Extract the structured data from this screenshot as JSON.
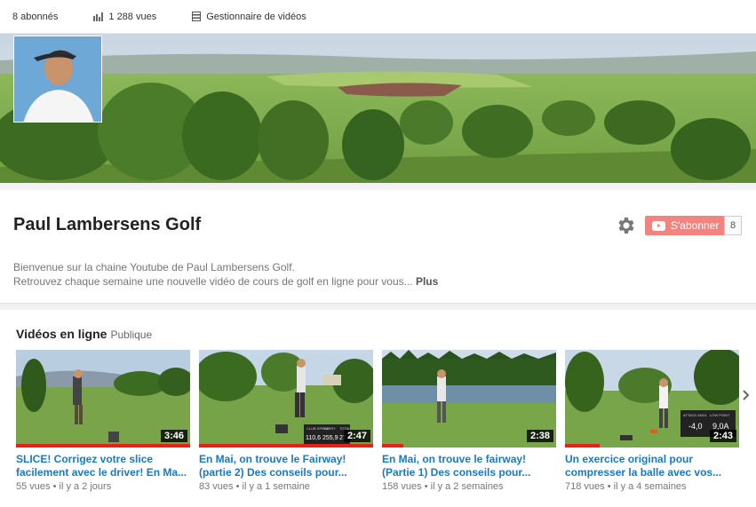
{
  "topbar": {
    "subscribers": "8 abonnés",
    "views": "1 288 vues",
    "video_manager": "Gestionnaire de vidéos"
  },
  "channel": {
    "name": "Paul Lambersens Golf",
    "subscribe_label": "S'abonner",
    "subscriber_count": "8",
    "description_line1": "Bienvenue sur la chaine Youtube de Paul Lambersens Golf.",
    "description_line2": "Retrouvez chaque semaine une nouvelle vidéo de cours de golf en ligne pour vous...",
    "more_label": "Plus"
  },
  "section": {
    "title": "Vidéos en ligne",
    "visibility": "Publique"
  },
  "videos": [
    {
      "title": "SLICE! Corrigez votre slice facilement avec le driver! En Ma...",
      "views": "55 vues",
      "age": "il y a 2 jours",
      "duration": "3:46",
      "progress": 1.0
    },
    {
      "title": "En Mai, on trouve le Fairway! (partie 2) Des conseils pour...",
      "views": "83 vues",
      "age": "il y a 1 semaine",
      "duration": "2:47",
      "progress": 1.0
    },
    {
      "title": "En Mai, on trouve le fairway! (Partie 1) Des conseils pour...",
      "views": "158 vues",
      "age": "il y a 2 semaines",
      "duration": "2:38",
      "progress": 0.12
    },
    {
      "title": "Un exercice original pour compresser la balle avec vos...",
      "views": "718 vues",
      "age": "il y a 4 semaines",
      "duration": "2:43",
      "progress": 0.2
    }
  ],
  "overlays": {
    "v2": {
      "labels": [
        "CLUB SPEED",
        "CARRY",
        "TOTAL"
      ],
      "values": [
        "110,6",
        "255,9",
        "27"
      ]
    },
    "v4": {
      "labels": [
        "ATTACK ANGL",
        "LOW POINT"
      ],
      "values": [
        "-4,0",
        "9,0A"
      ]
    }
  },
  "colors": {
    "link": "#167ac6",
    "subscribe": "#e62117",
    "progress": "#e62117"
  }
}
